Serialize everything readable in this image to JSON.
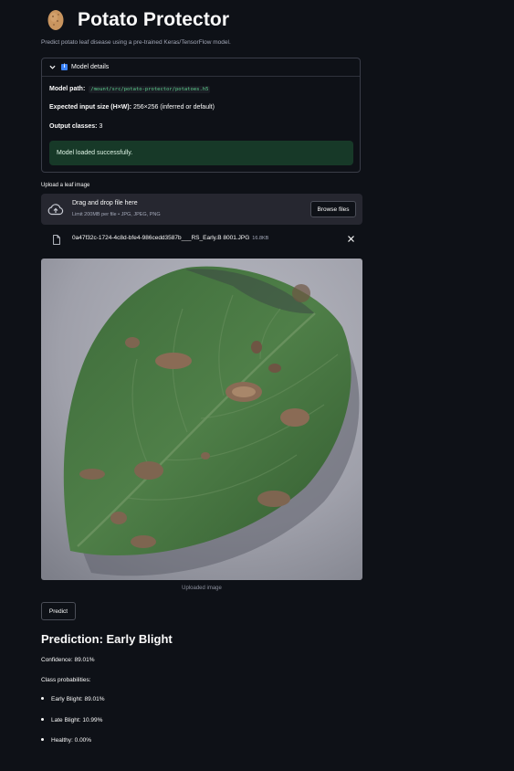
{
  "header": {
    "title": "Potato Protector",
    "subtitle": "Predict potato leaf disease using a pre-trained Keras/TensorFlow model."
  },
  "model_details": {
    "label": "Model details",
    "path_label": "Model path:",
    "path_value": "/mount/src/potato-protector/potatoes.h5",
    "input_size_label": "Expected input size (H×W):",
    "input_size_value": "256×256 (inferred or default)",
    "output_classes_label": "Output classes:",
    "output_classes_value": "3",
    "status": "Model loaded successfully."
  },
  "uploader": {
    "label": "Upload a leaf image",
    "drop_title": "Drag and drop file here",
    "drop_limit": "Limit 200MB per file • JPG, JPEG, PNG",
    "browse_label": "Browse files",
    "file_name": "0a47f32c-1724-4c8d-bfe4-986cedd3587b___RS_Early.B 8001.JPG",
    "file_size": "16.8KB"
  },
  "image": {
    "caption": "Uploaded image"
  },
  "predict_button": "Predict",
  "result": {
    "title": "Prediction: Early Blight",
    "confidence": "Confidence: 89.01%",
    "probabilities_label": "Class probabilities:",
    "probabilities": [
      "Early Blight: 89.01%",
      "Late Blight: 10.99%",
      "Healthy: 0.00%"
    ]
  },
  "colors": {
    "background": "#0e1117",
    "success_bg": "#173928",
    "dropzone_bg": "#262730",
    "code_text": "#5dcf8e",
    "info_icon": "#3b82f6"
  },
  "icons": [
    "potato-icon",
    "chevron-down-icon",
    "info-icon",
    "cloud-upload-icon",
    "file-icon",
    "close-icon"
  ]
}
